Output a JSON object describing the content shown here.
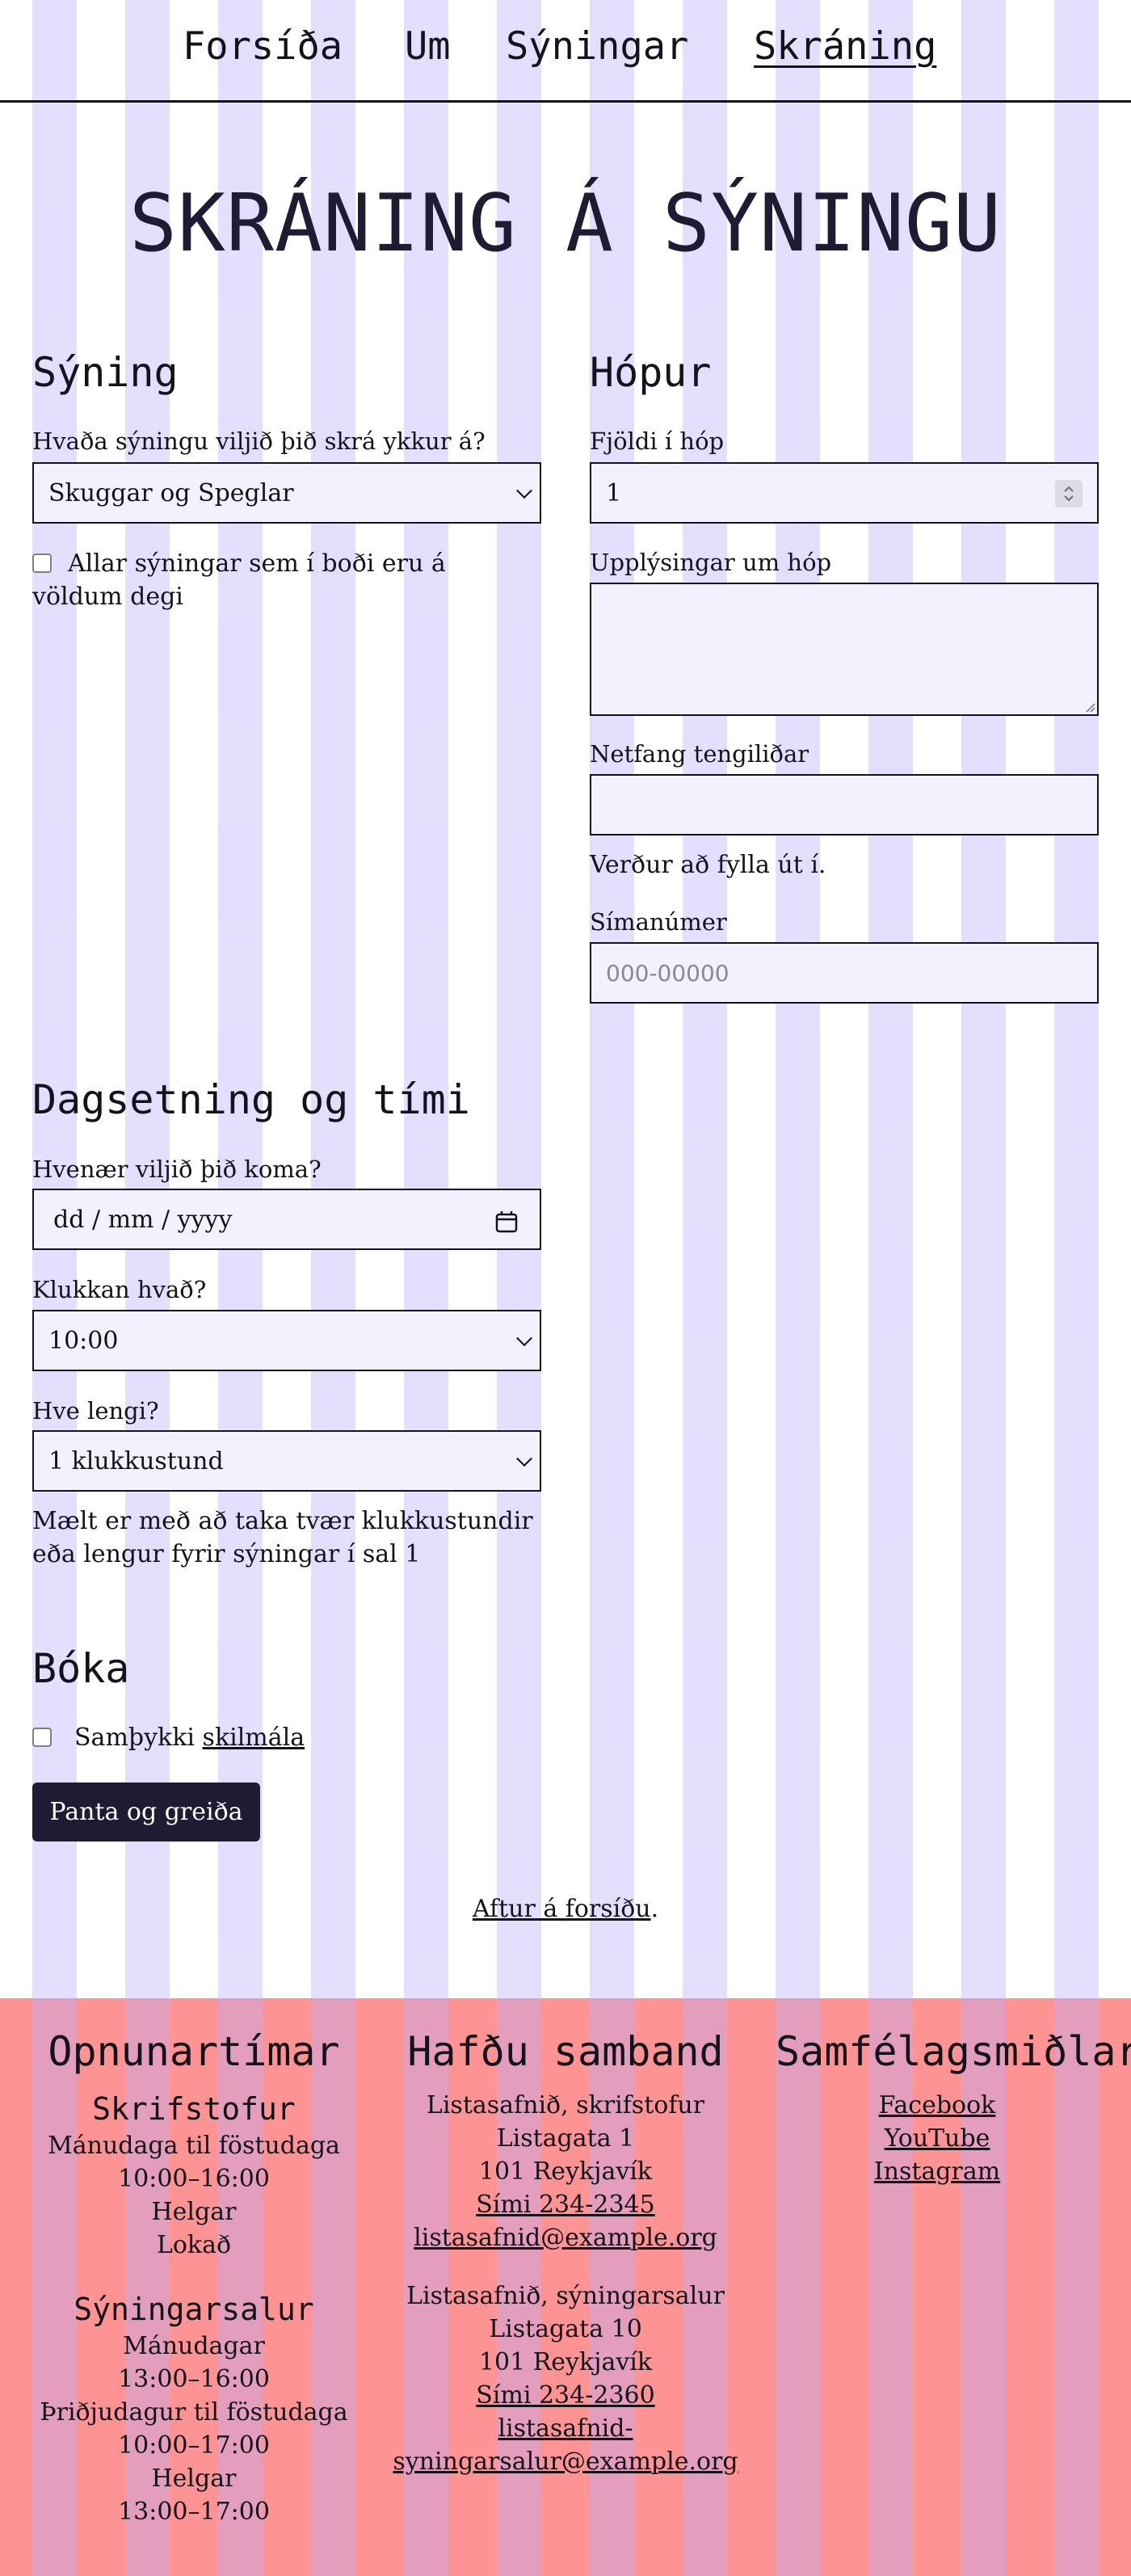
{
  "nav": {
    "items": [
      "Forsíða",
      "Um",
      "Sýningar",
      "Skráning"
    ],
    "active": "Skráning"
  },
  "title": "SKRÁNING Á SÝNINGU",
  "syning": {
    "heading": "Sýning",
    "question": "Hvaða sýningu viljið þið skrá ykkur á?",
    "selected": "Skuggar og Speglar",
    "all_label": "Allar sýningar sem í boði eru á völdum degi",
    "all_checked": false
  },
  "hopur": {
    "heading": "Hópur",
    "count_label": "Fjöldi í hóp",
    "count_value": "1",
    "info_label": "Upplýsingar um hóp",
    "info_value": "",
    "email_label": "Netfang tengiliðar",
    "email_value": "",
    "email_error": "Verður að fylla út í.",
    "phone_label": "Símanúmer",
    "phone_placeholder": "000-00000"
  },
  "timi": {
    "heading": "Dagsetning og tími",
    "date_label": "Hvenær viljið þið koma?",
    "date_placeholder": "dd / mm / yyyy",
    "time_label": "Klukkan hvað?",
    "time_value": "10:00",
    "duration_label": "Hve lengi?",
    "duration_value": "1 klukkustund",
    "note": "Mælt er með að taka tvær klukkustundir eða lengur fyrir sýningar í sal 1"
  },
  "boka": {
    "heading": "Bóka",
    "agree_prefix": "Samþykki",
    "agree_link": "skilmála",
    "agree_checked": false,
    "submit_label": "Panta og greiða"
  },
  "back": {
    "link": "Aftur á forsíðu",
    "suffix": "."
  },
  "footer": {
    "hours": {
      "heading": "Opnunartímar",
      "office_heading": "Skrifstofur",
      "office_lines": [
        "Mánudaga til föstudaga",
        "10:00–16:00",
        "Helgar",
        "Lokað"
      ],
      "hall_heading": "Sýningarsalur",
      "hall_lines": [
        "Mánudagar",
        "13:00–16:00",
        "Þriðjudagur til föstudaga",
        "10:00–17:00",
        "Helgar",
        "13:00–17:00"
      ]
    },
    "contact": {
      "heading": "Hafðu samband",
      "office": {
        "name": "Listasafnið, skrifstofur",
        "street": "Listagata 1",
        "city": "101 Reykjavík",
        "phone": "Sími 234-2345",
        "email": "listasafnid@example.org"
      },
      "hall": {
        "name": "Listasafnið, sýningarsalur",
        "street": "Listagata 10",
        "city": "101 Reykjavík",
        "phone": "Sími 234-2360",
        "email_line1": "listasafnid-",
        "email_line2": "syningarsalur@example.org"
      }
    },
    "social": {
      "heading": "Samfélagsmiðlar",
      "links": [
        "Facebook",
        "YouTube",
        "Instagram"
      ]
    }
  }
}
